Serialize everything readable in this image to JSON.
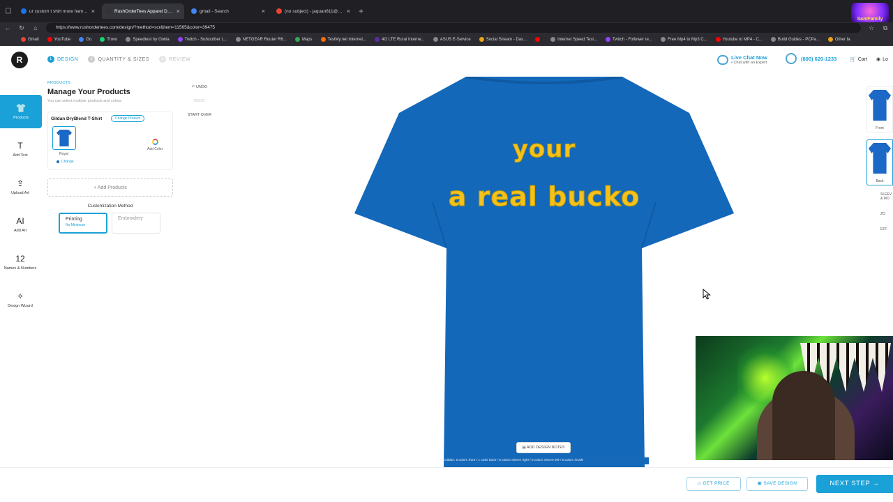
{
  "browser": {
    "tabs": [
      {
        "title": "ur custom t shirt more hampton",
        "color": "#1a73e8",
        "active": false
      },
      {
        "title": "RushOrderTees Apparel Design S",
        "color": "#333",
        "active": true
      },
      {
        "title": "gmail - Search",
        "color": "#4285f4",
        "active": false
      },
      {
        "title": "(no subject) - jaquan811@gmail",
        "color": "#ea4335",
        "active": false
      }
    ],
    "url": "https://www.rushordertees.com/design/?method=scr&item=11565&color=39475",
    "bookmarks": [
      {
        "label": "Gmail",
        "color": "#ea4335"
      },
      {
        "label": "YouTube",
        "color": "#ff0000"
      },
      {
        "label": "Go",
        "color": "#4285f4"
      },
      {
        "label": "Trovo",
        "color": "#1ecf6c"
      },
      {
        "label": "Speedtest by Ookla",
        "color": "#888"
      },
      {
        "label": "Twitch - Subscriber L...",
        "color": "#9146ff"
      },
      {
        "label": "NETGEAR Router R6...",
        "color": "#888"
      },
      {
        "label": "Maps",
        "color": "#34a853"
      },
      {
        "label": "TestMy.net Internet...",
        "color": "#ff6d00"
      },
      {
        "label": "4G LTE Rural Interne...",
        "color": "#5b2ca0"
      },
      {
        "label": "ASUS E-Service",
        "color": "#888"
      },
      {
        "label": "Social Stream - Das...",
        "color": "#e8a317"
      },
      {
        "label": "",
        "color": "#ff0000"
      },
      {
        "label": "Internet Speed Test...",
        "color": "#888"
      },
      {
        "label": "Twitch - Follower re...",
        "color": "#9146ff"
      },
      {
        "label": "Free Mp4 to Mp3 C...",
        "color": "#888"
      },
      {
        "label": "Youtube to MP4 - C...",
        "color": "#ff0000"
      },
      {
        "label": "Build Guides - PCPa...",
        "color": "#888"
      },
      {
        "label": "Other fa",
        "color": "#e8a317"
      }
    ],
    "profile_text": "SamFamily"
  },
  "app": {
    "logo": "R",
    "steps": [
      {
        "num": "1",
        "label": "DESIGN",
        "state": "active"
      },
      {
        "num": "2",
        "label": "QUANTITY & SIZES",
        "state": "normal"
      },
      {
        "num": "3",
        "label": "REVIEW",
        "state": "dim"
      }
    ],
    "chat": {
      "title": "Live Chat Now",
      "sub": "• Chat with an Expert"
    },
    "phone": "(800) 620-1233",
    "cart": "Cart",
    "login": "Lo",
    "sidebar": [
      {
        "label": "Products",
        "icon": "shirt-icon",
        "glyph": "👕"
      },
      {
        "label": "Add Text",
        "icon": "text-icon",
        "glyph": "T"
      },
      {
        "label": "Upload Art",
        "icon": "upload-icon",
        "glyph": "⇪"
      },
      {
        "label": "Add Art",
        "icon": "ai-art-icon",
        "glyph": "AI"
      },
      {
        "label": "Names & Numbers",
        "icon": "numbers-icon",
        "glyph": "12"
      },
      {
        "label": "Design Wizard",
        "icon": "wand-icon",
        "glyph": "✧"
      }
    ],
    "panel": {
      "kicker": "PRODUCTS",
      "title": "Manage Your Products",
      "sub": "You can select multiple products and colors.",
      "product_name": "Gildan DryBlend T-Shirt",
      "change_product": "Change Product",
      "color_name": "Royal",
      "change": "Change",
      "add_color": "Add Color",
      "add_products": "+  Add Products",
      "customization_title": "Customization Method",
      "printing": "Printing",
      "printing_sub": "No Minimum",
      "embroidery": "Embroidery"
    },
    "tools": {
      "undo": "↶ UNDO",
      "redo": "REDO",
      "start_over": "START OVER"
    },
    "design": {
      "line1": "your",
      "line2": "a real bucko",
      "shirt_color": "#1468b9",
      "text_color": "#f4c21b"
    },
    "add_notes": "ADD DESIGN NOTES",
    "colors_summary": "Gildan: 6 colors front  /  1 color back  /  0 colors sleeve right  /  0 colors sleeve left  /  0 colors inside",
    "views": [
      {
        "label": "Front",
        "selected": false
      },
      {
        "label": "Back",
        "selected": true
      }
    ],
    "view_links": [
      "SLEEV & MO",
      "ZO",
      "EFF"
    ],
    "bottom": {
      "get_price": "GET PRICE",
      "save_design": "SAVE DESIGN",
      "next_step": "NEXT STEP  →"
    }
  }
}
